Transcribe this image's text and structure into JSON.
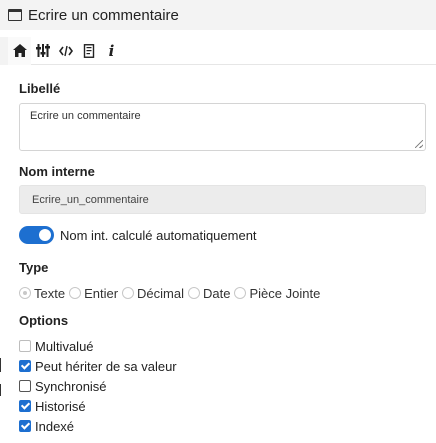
{
  "window": {
    "title": "Ecrire un commentaire",
    "icon": "window-icon"
  },
  "toolbar": {
    "buttons": [
      {
        "name": "home",
        "icon": "home-icon"
      },
      {
        "name": "settings",
        "icon": "sliders-icon"
      },
      {
        "name": "code",
        "icon": "code-icon"
      },
      {
        "name": "script",
        "icon": "document-icon"
      },
      {
        "name": "info",
        "icon": "info-icon",
        "glyph": "i"
      }
    ]
  },
  "form": {
    "libelle": {
      "label": "Libellé",
      "value": "Ecrire un commentaire"
    },
    "nom_interne": {
      "label": "Nom interne",
      "value": "Ecrire_un_commentaire"
    },
    "auto_toggle": {
      "label": "Nom int. calculé automatiquement",
      "on": true
    },
    "type": {
      "label": "Type",
      "options": [
        "Texte",
        "Entier",
        "Décimal",
        "Date",
        "Pièce Jointe"
      ],
      "selected": "Texte"
    },
    "options": {
      "label": "Options",
      "items": [
        {
          "label": "Multivalué",
          "checked": false,
          "disabled": true
        },
        {
          "label": "Peut hériter de sa valeur",
          "checked": true,
          "disabled": false
        },
        {
          "label": "Synchronisé",
          "checked": false,
          "disabled": false
        },
        {
          "label": "Historisé",
          "checked": true,
          "disabled": false
        },
        {
          "label": "Indexé",
          "checked": true,
          "disabled": false
        }
      ]
    }
  },
  "colors": {
    "accent": "#1d6fd0",
    "titlebar": "#f3f3f3",
    "readonly_bg": "#ececec"
  }
}
